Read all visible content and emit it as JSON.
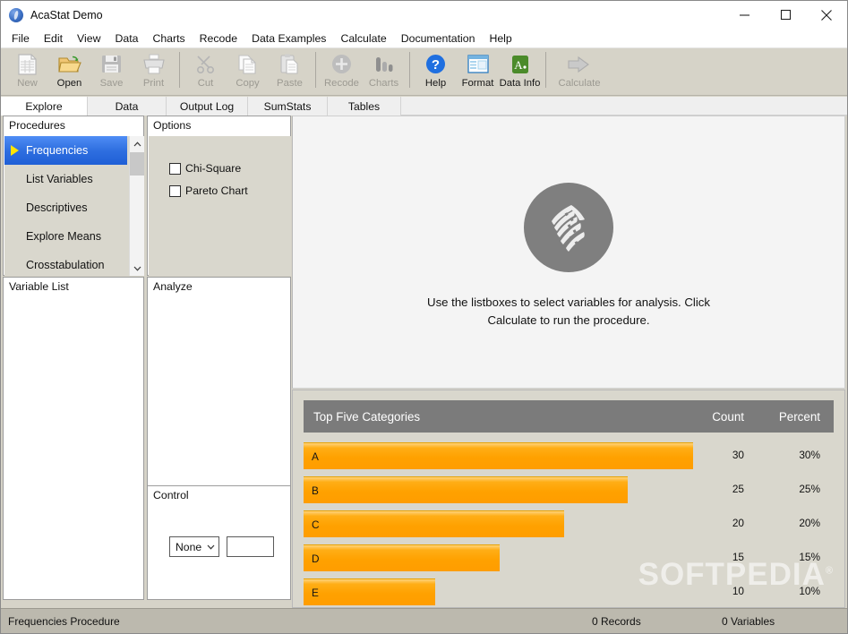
{
  "window": {
    "title": "AcaStat Demo",
    "icon": "acastat-app-icon",
    "minimize": "minimize-icon",
    "maximize": "maximize-icon",
    "close": "close-icon"
  },
  "menubar": {
    "items": [
      "File",
      "Edit",
      "View",
      "Data",
      "Charts",
      "Recode",
      "Data Examples",
      "Calculate",
      "Documentation",
      "Help"
    ]
  },
  "toolbar": {
    "buttons": [
      {
        "label": "New",
        "icon": "new-document-icon",
        "enabled": false
      },
      {
        "label": "Open",
        "icon": "open-folder-icon",
        "enabled": true
      },
      {
        "label": "Save",
        "icon": "floppy-disk-icon",
        "enabled": false
      },
      {
        "label": "Print",
        "icon": "printer-icon",
        "enabled": false
      },
      {
        "label": "Cut",
        "icon": "scissors-icon",
        "enabled": false
      },
      {
        "label": "Copy",
        "icon": "copy-pages-icon",
        "enabled": false
      },
      {
        "label": "Paste",
        "icon": "clipboard-icon",
        "enabled": false
      },
      {
        "label": "Recode",
        "icon": "plus-circle-icon",
        "enabled": false
      },
      {
        "label": "Charts",
        "icon": "bar-chart-icon",
        "enabled": false
      },
      {
        "label": "Help",
        "icon": "question-circle-icon",
        "enabled": true
      },
      {
        "label": "Format",
        "icon": "window-format-icon",
        "enabled": true
      },
      {
        "label": "Data Info",
        "icon": "green-a-icon",
        "enabled": true
      },
      {
        "label": "Calculate",
        "icon": "right-arrow-icon",
        "enabled": false
      }
    ]
  },
  "tabs": [
    {
      "label": "Explore",
      "active": true
    },
    {
      "label": "Data",
      "active": false
    },
    {
      "label": "Output Log",
      "active": false
    },
    {
      "label": "SumStats",
      "active": false
    },
    {
      "label": "Tables",
      "active": false
    }
  ],
  "procedures": {
    "title": "Procedures",
    "items": [
      "Frequencies",
      "List Variables",
      "Descriptives",
      "Explore Means",
      "Crosstabulation"
    ],
    "selected": "Frequencies"
  },
  "variable_list": {
    "title": "Variable List",
    "items": []
  },
  "options": {
    "title": "Options",
    "checkboxes": [
      {
        "label": "Chi-Square",
        "checked": false
      },
      {
        "label": "Pareto Chart",
        "checked": false
      }
    ]
  },
  "analyze": {
    "title": "Analyze",
    "items": []
  },
  "control": {
    "title": "Control",
    "select_value": "None",
    "text_value": ""
  },
  "message_panel": {
    "logo": "acastat-waving-page-logo",
    "line1": "Use the listboxes to select variables for analysis.  Click",
    "line2": "Calculate to run the procedure."
  },
  "watermark": {
    "text": "SOFTPEDIA",
    "mark": "®"
  },
  "statusbar": {
    "procedure": "Frequencies Procedure",
    "records": "0 Records",
    "variables": "0 Variables"
  },
  "colors": {
    "accent_selection": "#2f6fe0",
    "bar_orange": "#ff9d00",
    "header_grey": "#7b7b7b",
    "panel_beige": "#d9d7cd",
    "chrome_beige": "#d6d3c8"
  },
  "chart_data": {
    "type": "bar",
    "title": "Top Five Categories",
    "orientation": "horizontal",
    "columns": [
      "Top Five Categories",
      "Count",
      "Percent"
    ],
    "categories": [
      "A",
      "B",
      "C",
      "D",
      "E"
    ],
    "values": [
      30,
      25,
      20,
      15,
      10
    ],
    "percents": [
      "30%",
      "25%",
      "20%",
      "15%",
      "10%"
    ],
    "counts": [
      "30",
      "25",
      "20",
      "15",
      "10"
    ],
    "xlabel": "",
    "ylabel": "",
    "xlim": [
      0,
      30
    ],
    "grid": false,
    "legend": "none",
    "rows": [
      {
        "category": "A",
        "count": "30",
        "percent": "30%",
        "value": 30
      },
      {
        "category": "B",
        "count": "25",
        "percent": "25%",
        "value": 25
      },
      {
        "category": "C",
        "count": "20",
        "percent": "20%",
        "value": 20
      },
      {
        "category": "D",
        "count": "15",
        "percent": "15%",
        "value": 15
      },
      {
        "category": "E",
        "count": "10",
        "percent": "10%",
        "value": 10
      }
    ]
  }
}
